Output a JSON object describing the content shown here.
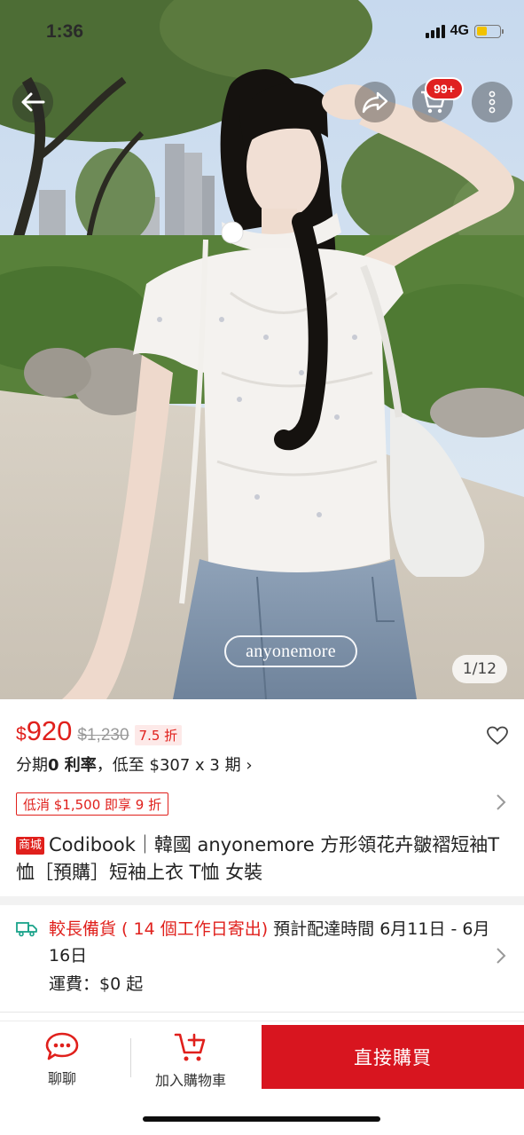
{
  "status_bar": {
    "time": "1:36",
    "network": "4G",
    "battery_level": 0.45
  },
  "gallery": {
    "watermark": "anyonemore",
    "counter": "1/12"
  },
  "header": {
    "cart_badge": "99+"
  },
  "price": {
    "currency": "$",
    "current": "920",
    "original": "$1,230",
    "discount": "7.5 折"
  },
  "installment": {
    "prefix": "分期",
    "bold": "0 利率",
    "rest": "，低至 $307 x 3 期 ›"
  },
  "coupon": {
    "label": "低消 $1,500 即享 9 折"
  },
  "product": {
    "mall_tag": "商城",
    "title": "Codibook｜韓國 anyonemore 方形領花卉皺褶短袖T恤［預購］短袖上衣 T恤 女裝"
  },
  "shipping": {
    "highlight": "較長備貨 ( 14 個工作日寄出)",
    "estimate": " 預計配達時間 6月11日 - 6月16日",
    "fee": "運費：$0 起"
  },
  "bottom_bar": {
    "chat_label": "聊聊",
    "cart_label": "加入購物車",
    "buy_label": "直接購買"
  },
  "colors": {
    "accent": "#e0201c",
    "buy_button": "#d8151f",
    "shipping_icon": "#1aa38a"
  }
}
